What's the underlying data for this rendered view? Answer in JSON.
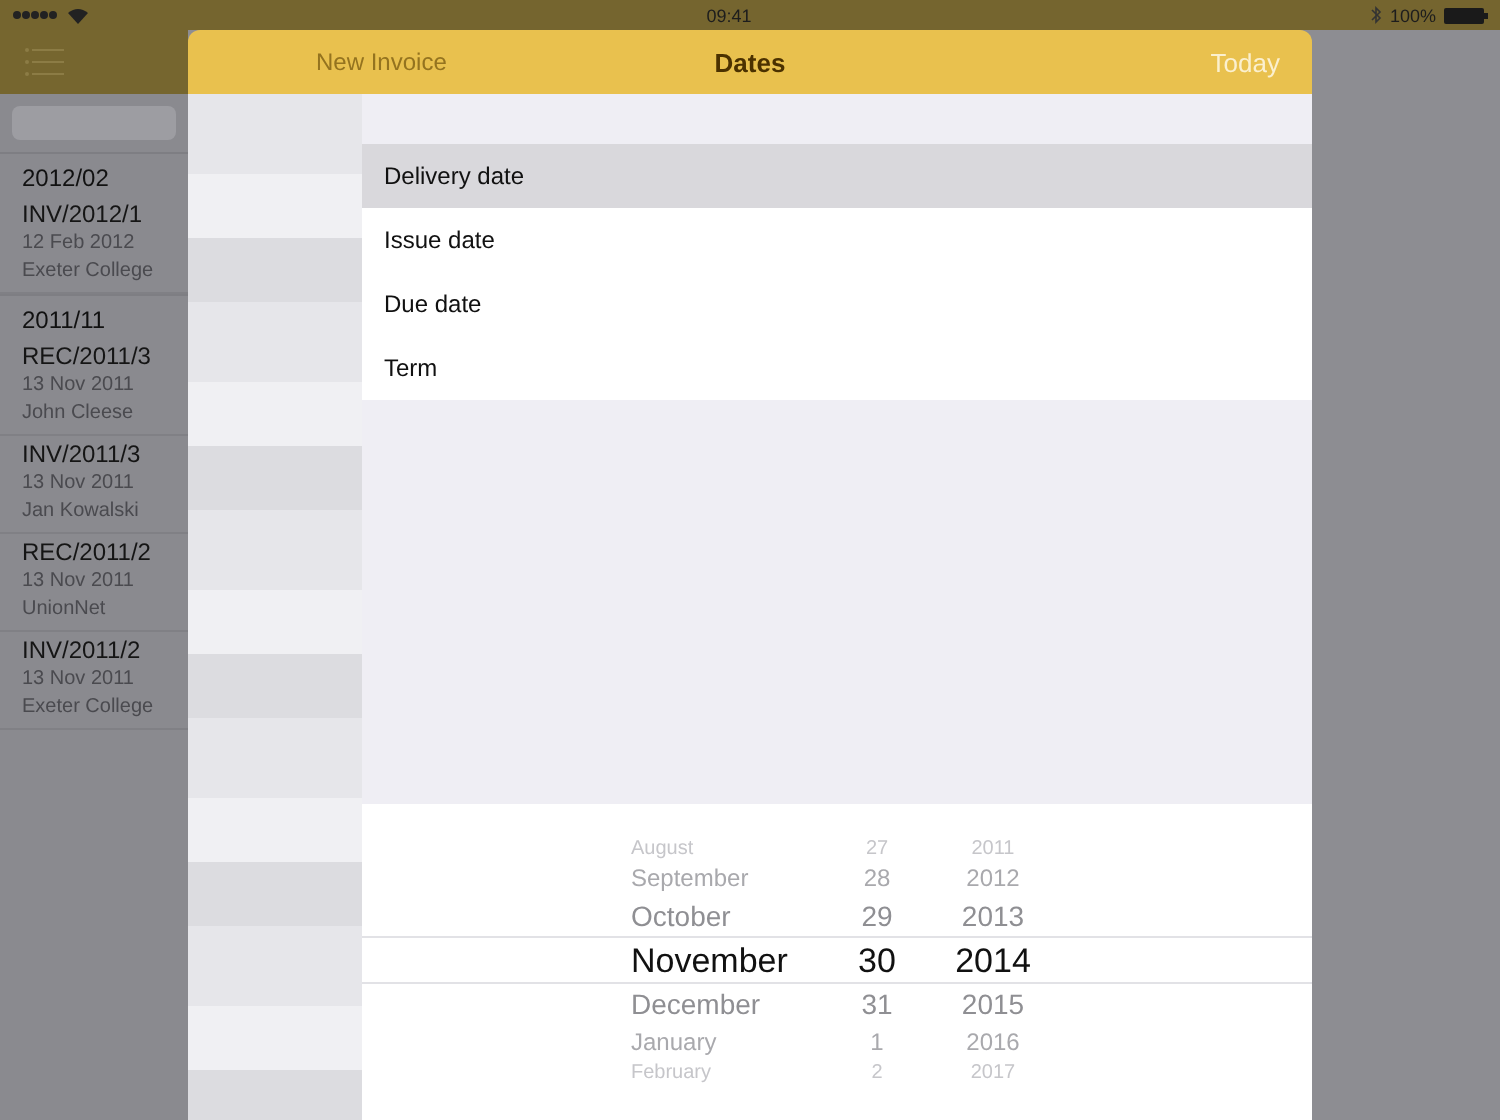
{
  "status_bar": {
    "time": "09:41",
    "battery": "100%"
  },
  "background": {
    "title": "New Invoice",
    "sections": [
      {
        "header": "2012/02",
        "items": [
          {
            "number": "INV/2012/1",
            "date": "12 Feb 2012",
            "client": "Exeter College"
          }
        ]
      },
      {
        "header": "2011/11",
        "items": [
          {
            "number": "REC/2011/3",
            "date": "13 Nov 2011",
            "client": "John Cleese"
          },
          {
            "number": "INV/2011/3",
            "date": "13 Nov 2011",
            "client": "Jan Kowalski"
          },
          {
            "number": "REC/2011/2",
            "date": "13 Nov 2011",
            "client": "UnionNet"
          },
          {
            "number": "INV/2011/2",
            "date": "13 Nov 2011",
            "client": "Exeter College"
          }
        ]
      }
    ]
  },
  "dialog": {
    "title": "Dates",
    "action": "Today",
    "options": [
      {
        "label": "Delivery date",
        "selected": true
      },
      {
        "label": "Issue date",
        "selected": false
      },
      {
        "label": "Due date",
        "selected": false
      },
      {
        "label": "Term",
        "selected": false
      }
    ],
    "picker": {
      "months": [
        {
          "label": "August",
          "selected": false
        },
        {
          "label": "September",
          "selected": false
        },
        {
          "label": "October",
          "selected": false
        },
        {
          "label": "November",
          "selected": true
        },
        {
          "label": "December",
          "selected": false
        },
        {
          "label": "January",
          "selected": false
        },
        {
          "label": "February",
          "selected": false
        }
      ],
      "days": [
        {
          "label": "27",
          "selected": false
        },
        {
          "label": "28",
          "selected": false
        },
        {
          "label": "29",
          "selected": false
        },
        {
          "label": "30",
          "selected": true
        },
        {
          "label": "31",
          "selected": false
        },
        {
          "label": "1",
          "selected": false
        },
        {
          "label": "2",
          "selected": false
        }
      ],
      "years": [
        {
          "label": "2011",
          "selected": false
        },
        {
          "label": "2012",
          "selected": false
        },
        {
          "label": "2013",
          "selected": false
        },
        {
          "label": "2014",
          "selected": true
        },
        {
          "label": "2015",
          "selected": false
        },
        {
          "label": "2016",
          "selected": false
        },
        {
          "label": "2017",
          "selected": false
        }
      ]
    }
  }
}
